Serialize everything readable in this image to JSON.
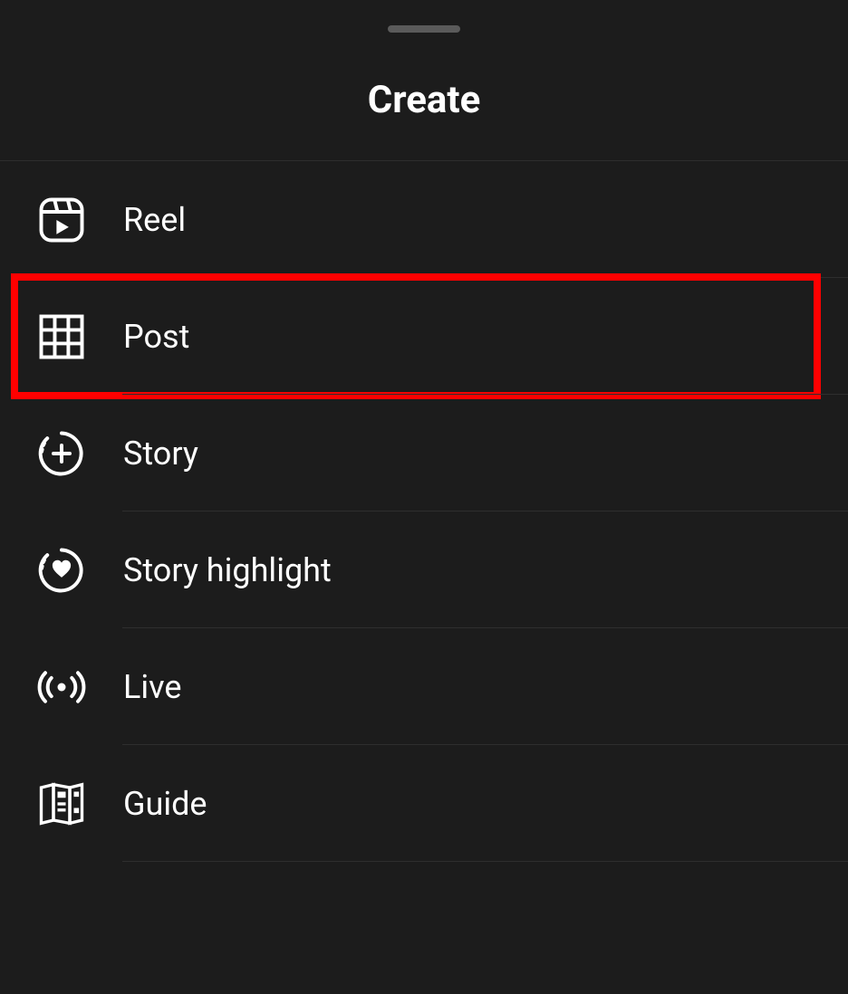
{
  "header": {
    "title": "Create"
  },
  "menu": {
    "items": [
      {
        "label": "Reel",
        "icon": "reel-icon",
        "highlighted": false
      },
      {
        "label": "Post",
        "icon": "grid-icon",
        "highlighted": true
      },
      {
        "label": "Story",
        "icon": "story-plus-icon",
        "highlighted": false
      },
      {
        "label": "Story highlight",
        "icon": "story-heart-icon",
        "highlighted": false
      },
      {
        "label": "Live",
        "icon": "live-icon",
        "highlighted": false
      },
      {
        "label": "Guide",
        "icon": "guide-icon",
        "highlighted": false
      }
    ]
  }
}
